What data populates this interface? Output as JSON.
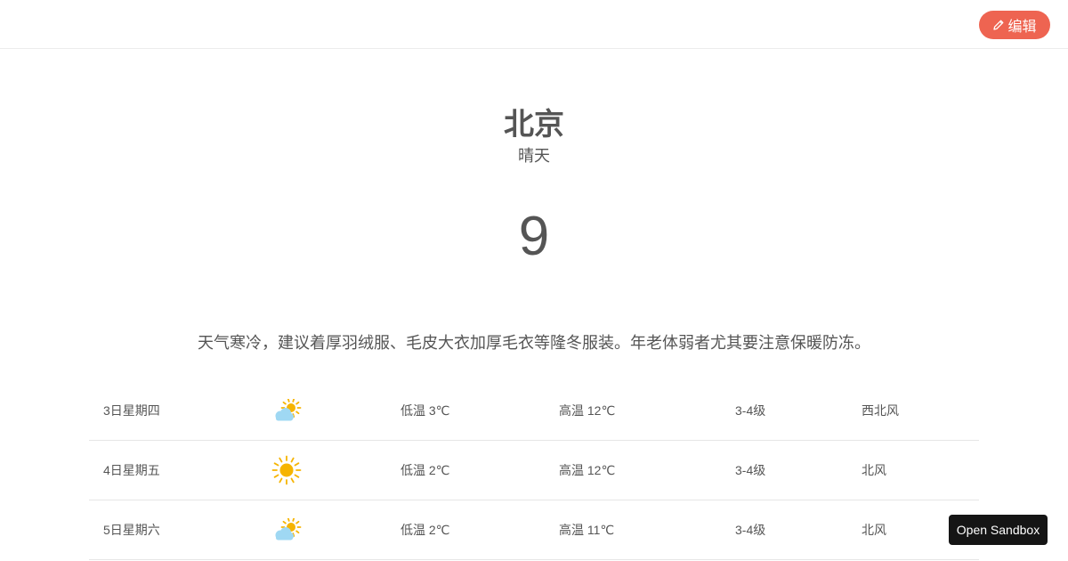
{
  "header": {
    "edit_button_label": "编辑",
    "edit_button_icon": "pencil-icon",
    "accent_color": "#ee6451"
  },
  "city": {
    "name": "北京",
    "weather_now": "晴天",
    "temperature": "9"
  },
  "tips": "天气寒冷，建议着厚羽绒服、毛皮大衣加厚毛衣等隆冬服装。年老体弱者尤其要注意保暖防冻。",
  "forecast": [
    {
      "date": "3日星期四",
      "icon": "partly-cloudy-icon",
      "low": "低温 3℃",
      "high": "高温 12℃",
      "wind_level": "3-4级",
      "wind_dir": "西北风"
    },
    {
      "date": "4日星期五",
      "icon": "sunny-icon",
      "low": "低温 2℃",
      "high": "高温 12℃",
      "wind_level": "3-4级",
      "wind_dir": "北风"
    },
    {
      "date": "5日星期六",
      "icon": "partly-cloudy-icon",
      "low": "低温 2℃",
      "high": "高温 11℃",
      "wind_level": "3-4级",
      "wind_dir": "北风"
    }
  ],
  "sandbox_button_label": "Open Sandbox",
  "colors": {
    "sun": "#f6b400",
    "cloud": "#9fd8f3",
    "text": "#555555",
    "sandbox_bg": "#151515"
  }
}
